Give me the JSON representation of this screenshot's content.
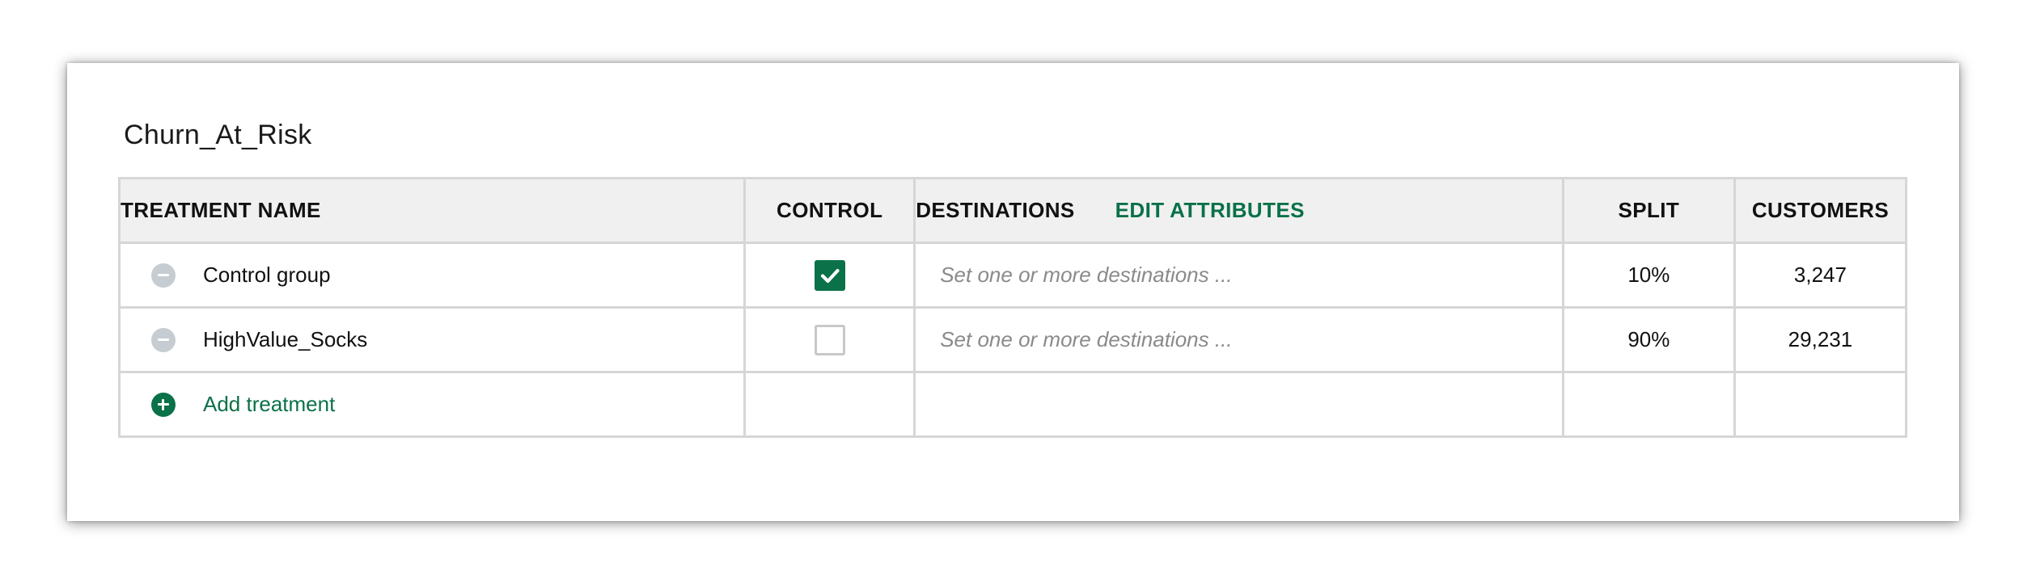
{
  "segment": {
    "title": "Churn_At_Risk"
  },
  "table": {
    "headers": {
      "treatment_name": "TREATMENT NAME",
      "control": "CONTROL",
      "destinations": "DESTINATIONS",
      "edit_attributes": "EDIT ATTRIBUTES",
      "split": "SPLIT",
      "customers": "CUSTOMERS"
    },
    "rows": [
      {
        "name": "Control group",
        "control": true,
        "destinations_placeholder": "Set one or more destinations ...",
        "split": "10%",
        "customers": "3,247"
      },
      {
        "name": "HighValue_Socks",
        "control": false,
        "destinations_placeholder": "Set one or more destinations ...",
        "split": "90%",
        "customers": "29,231"
      }
    ],
    "add_treatment_label": "Add treatment"
  },
  "colors": {
    "accent": "#0a7148",
    "remove_icon": "#c5ccd2",
    "header_bg": "#f0f0f0",
    "border": "#d6d6d6"
  },
  "icons": [
    "minus-circle-icon",
    "plus-circle-icon",
    "checkmark-icon"
  ]
}
